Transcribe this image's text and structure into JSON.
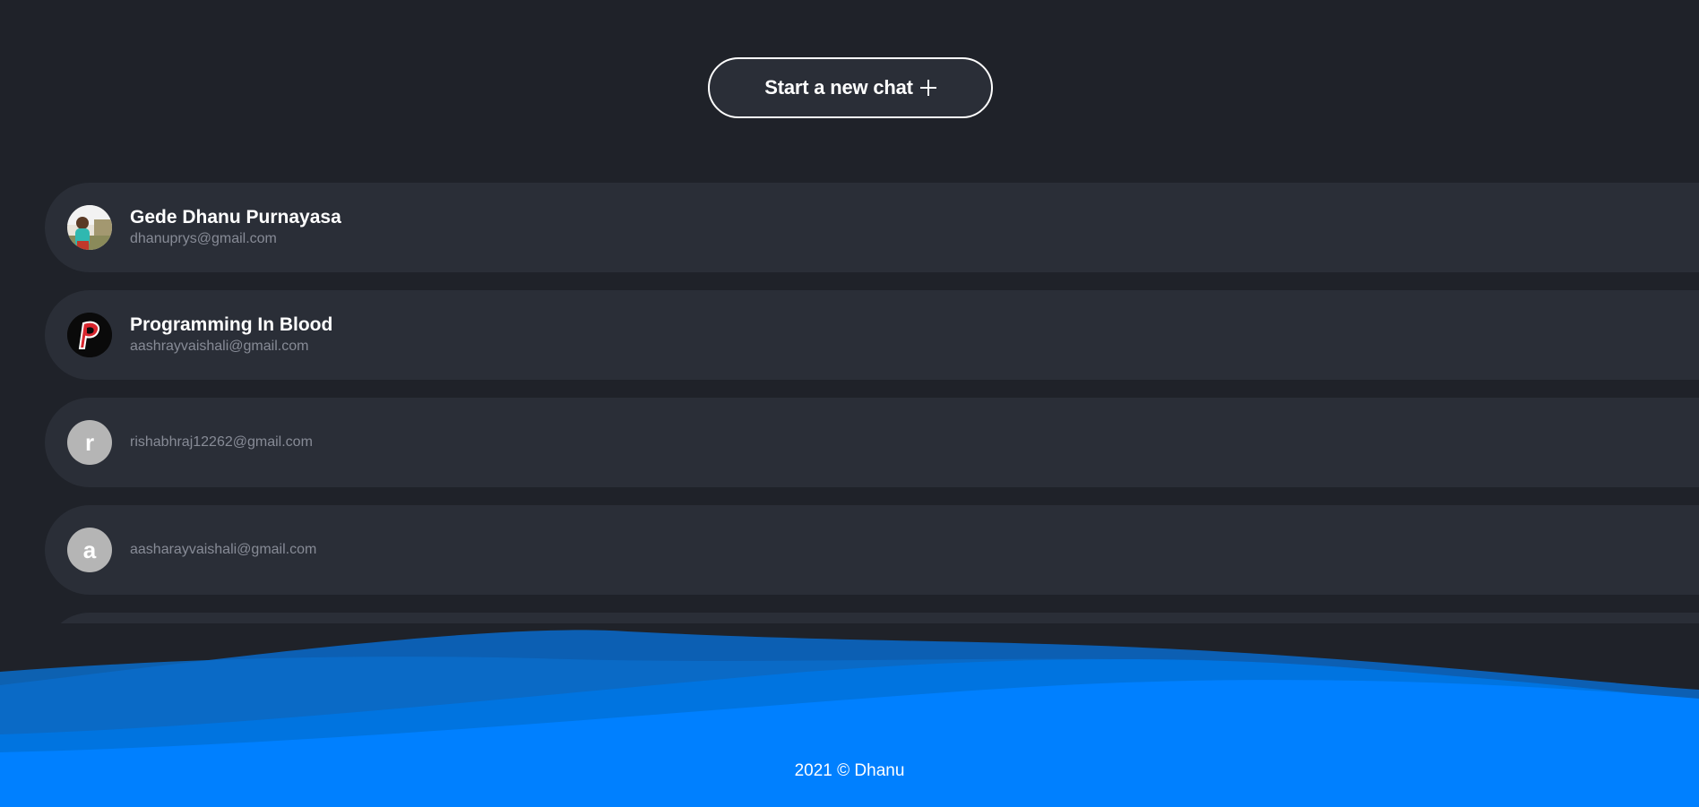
{
  "header": {
    "new_chat_label": "Start a new chat"
  },
  "chats": [
    {
      "name": "Gede Dhanu Purnayasa",
      "email": "dhanuprys@gmail.com",
      "avatar": "photo",
      "avatar_icon": "person-photo-icon"
    },
    {
      "name": "Programming In Blood",
      "email": "aashrayvaishali@gmail.com",
      "avatar": "logo",
      "avatar_icon": "p-logo-icon"
    },
    {
      "name": "",
      "email": "rishabhraj12262@gmail.com",
      "avatar": "letter",
      "avatar_letter": "r"
    },
    {
      "name": "",
      "email": "aasharayvaishali@gmail.com",
      "avatar": "letter",
      "avatar_letter": "a"
    }
  ],
  "footer": {
    "copyright": "2021 © Dhanu"
  },
  "colors": {
    "background": "#1f2229",
    "row_background": "#2a2e37",
    "accent_blue": "#0080ff",
    "wave_dark": "#0c5fb3",
    "email_gray": "#878b96",
    "letter_avatar_gray": "#b5b5b5"
  }
}
